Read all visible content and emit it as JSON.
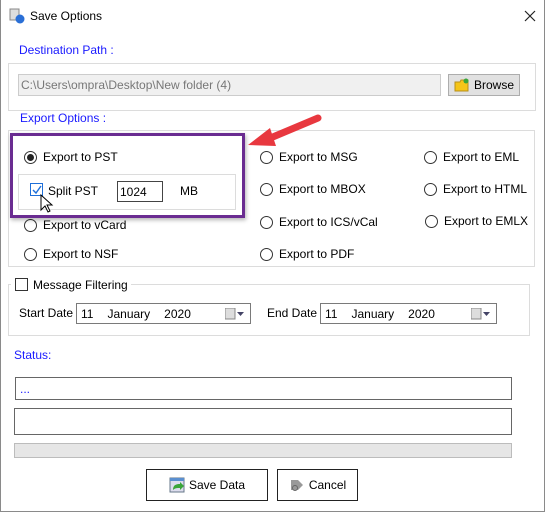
{
  "window": {
    "title": "Save Options",
    "close_icon": "close-icon"
  },
  "destination": {
    "label": "Destination Path :",
    "path": "C:\\Users\\ompra\\Desktop\\New folder (4)",
    "browse_label": "Browse"
  },
  "export": {
    "label": "Export Options :",
    "options": [
      {
        "label": "Export to PST",
        "selected": true
      },
      {
        "label": "Export to MSG",
        "selected": false
      },
      {
        "label": "Export to EML",
        "selected": false
      },
      {
        "label": "Export to MBOX",
        "selected": false
      },
      {
        "label": "Export to HTML",
        "selected": false
      },
      {
        "label": "Export to vCard",
        "selected": false
      },
      {
        "label": "Export to ICS/vCal",
        "selected": false
      },
      {
        "label": "Export to EMLX",
        "selected": false
      },
      {
        "label": "Export to NSF",
        "selected": false
      },
      {
        "label": "Export to PDF",
        "selected": false
      }
    ],
    "split": {
      "label": "Split PST",
      "checked": true,
      "value": "1024",
      "unit": "MB"
    }
  },
  "filter": {
    "label": "Message Filtering",
    "checked": false,
    "start_label": "Start Date",
    "start": {
      "day": "11",
      "month": "January",
      "year": "2020"
    },
    "end_label": "End Date",
    "end": {
      "day": "11",
      "month": "January",
      "year": "2020"
    }
  },
  "status": {
    "label": "Status:",
    "line1": "...",
    "line2": "",
    "progress": 0
  },
  "actions": {
    "save_label": "Save Data",
    "cancel_label": "Cancel"
  },
  "colors": {
    "highlight": "#6a2c91",
    "arrow": "#e8383f",
    "label_blue": "#1a1aff"
  }
}
